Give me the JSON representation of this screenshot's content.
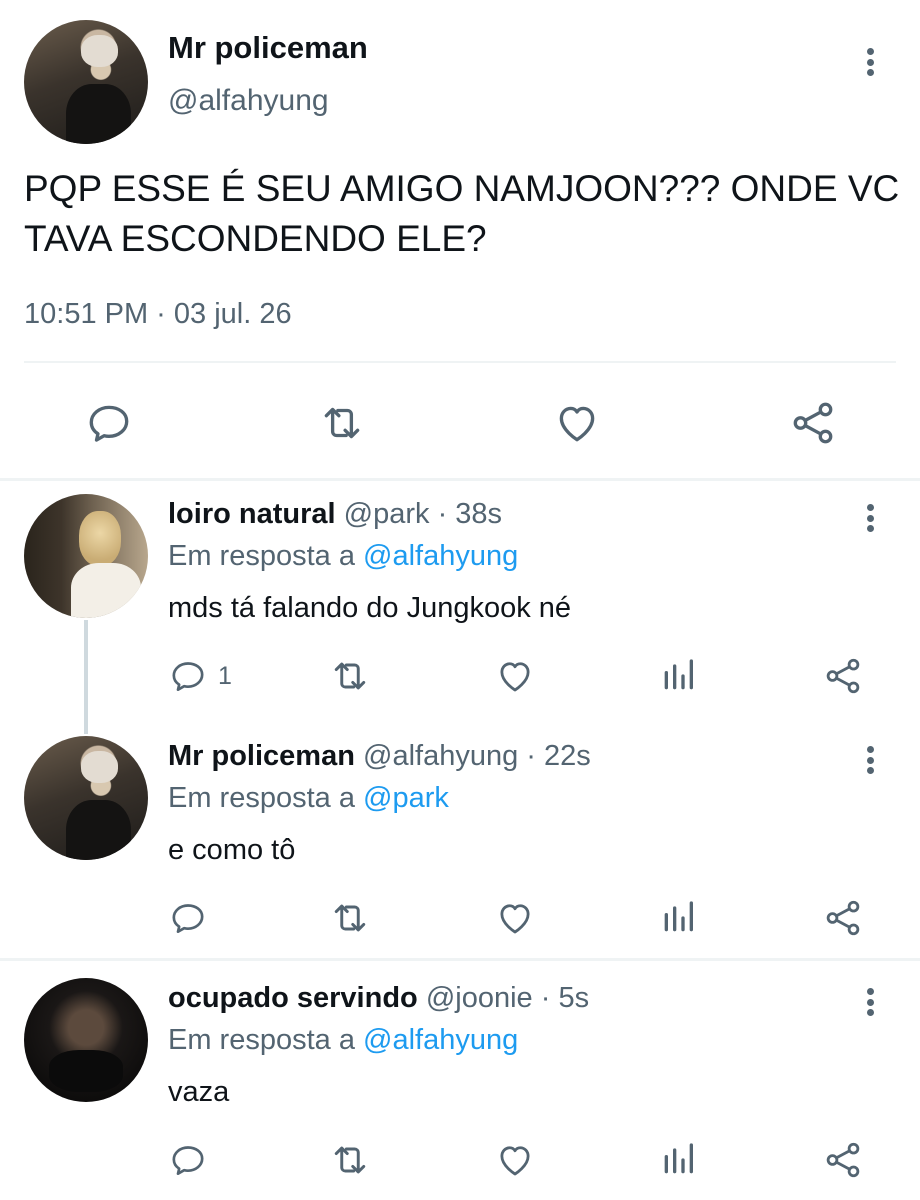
{
  "main_tweet": {
    "name": "Mr policeman",
    "handle": "@alfahyung",
    "text": "PQP ESSE É SEU AMIGO NAMJOON??? ONDE VC TAVA ESCONDENDO ELE?",
    "timestamp": "10:51 PM · 03 jul. 26",
    "actions": [
      "reply-icon",
      "retweet-icon",
      "like-icon",
      "share-icon"
    ]
  },
  "replies": [
    {
      "name": "loiro natural",
      "handle": "@park",
      "time": "· 38s",
      "reply_prefix": "Em resposta a ",
      "reply_to": "@alfahyung",
      "text": "mds tá falando do Jungkook né",
      "reply_count": "1"
    },
    {
      "name": "Mr policeman",
      "handle": "@alfahyung",
      "time": "· 22s",
      "reply_prefix": "Em resposta a ",
      "reply_to": "@park",
      "text": "e como tô",
      "reply_count": ""
    },
    {
      "name": "ocupado servindo",
      "handle": "@joonie",
      "time": "· 5s",
      "reply_prefix": "Em resposta a ",
      "reply_to": "@alfahyung",
      "text": "vaza",
      "reply_count": ""
    }
  ],
  "colors": {
    "text": "#0f1419",
    "muted": "#536471",
    "link": "#1d9bf0",
    "divider": "#eff3f4"
  }
}
